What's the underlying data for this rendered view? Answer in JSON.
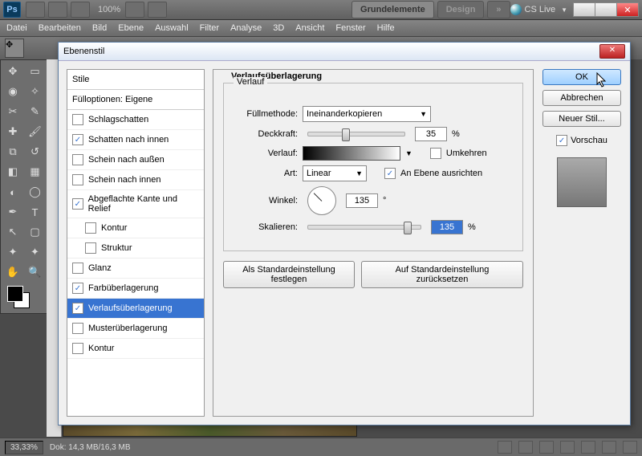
{
  "app": {
    "logo": "Ps",
    "zoom": "100%",
    "workspace_tabs": [
      "Grundelemente",
      "Design"
    ],
    "cslive": "CS Live"
  },
  "menu": [
    "Datei",
    "Bearbeiten",
    "Bild",
    "Ebene",
    "Auswahl",
    "Filter",
    "Analyse",
    "3D",
    "Ansicht",
    "Fenster",
    "Hilfe"
  ],
  "status": {
    "zoom": "33,33%",
    "doc": "Dok: 14,3 MB/16,3 MB"
  },
  "dialog": {
    "title": "Ebenenstil",
    "styles_head": "Stile",
    "styles_sub": "Füllopt​ionen: Eigene",
    "items": [
      {
        "label": "Schlagschatten",
        "checked": false
      },
      {
        "label": "Schatten nach innen",
        "checked": true
      },
      {
        "label": "Schein nach außen",
        "checked": false
      },
      {
        "label": "Schein nach innen",
        "checked": false
      },
      {
        "label": "Abgeflachte Kante und Relief",
        "checked": true
      },
      {
        "label": "Kontur",
        "checked": false,
        "indent": true
      },
      {
        "label": "Struktur",
        "checked": false,
        "indent": true
      },
      {
        "label": "Glanz",
        "checked": false
      },
      {
        "label": "Farbüberlagerung",
        "checked": true
      },
      {
        "label": "Verlaufsüberlagerung",
        "checked": true,
        "selected": true
      },
      {
        "label": "Musterüberlagerung",
        "checked": false
      },
      {
        "label": "Kontur",
        "checked": false
      }
    ],
    "group": "Verlaufsüberlagerung",
    "fieldset": "Verlauf",
    "fill_label": "Füllmethode:",
    "fill_value": "Ineinanderkopieren",
    "opacity_label": "Deckkraft:",
    "opacity_value": "35",
    "pct": "%",
    "grad_label": "Verlauf:",
    "reverse": "Umkehren",
    "type_label": "Art:",
    "type_value": "Linear",
    "align": "An Ebene ausrichten",
    "angle_label": "Winkel:",
    "angle_value": "135",
    "deg": "°",
    "scale_label": "Skalieren:",
    "scale_value": "135",
    "default_btn": "Als Standardeinstellung festlegen",
    "reset_btn": "Auf Standardeinstellung zurücksetzen",
    "ok": "OK",
    "cancel": "Abbrechen",
    "newstyle": "Neuer Stil...",
    "preview": "Vorschau"
  }
}
